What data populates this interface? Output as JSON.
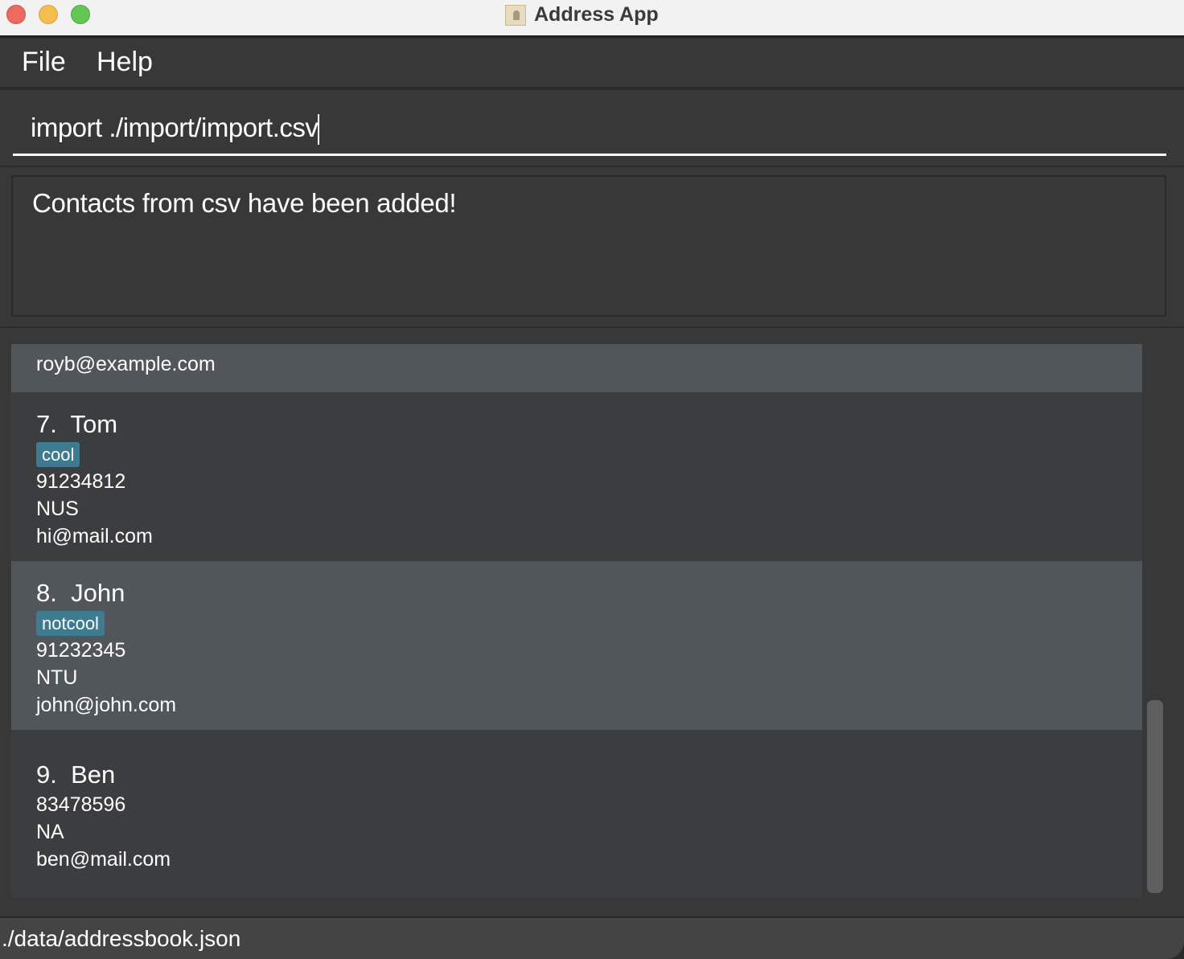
{
  "window": {
    "title": "Address App",
    "app_icon": "address-book-icon"
  },
  "menu": [
    "File",
    "Help"
  ],
  "command": {
    "value": "import ./import/import.csv"
  },
  "result": {
    "message": "Contacts from csv have been added!"
  },
  "contacts": [
    {
      "email": "royb@example.com"
    },
    {
      "index": "7.",
      "name": "Tom",
      "tags": [
        "cool"
      ],
      "phone": "91234812",
      "address": "NUS",
      "email": "hi@mail.com"
    },
    {
      "index": "8.",
      "name": "John",
      "tags": [
        "notcool"
      ],
      "phone": "91232345",
      "address": "NTU",
      "email": "john@john.com"
    },
    {
      "index": "9.",
      "name": "Ben",
      "tags": [],
      "phone": "83478596",
      "address": "NA",
      "email": "ben@mail.com"
    }
  ],
  "status": {
    "path": "./data/addressbook.json"
  },
  "colors": {
    "tag": "#3e7b91",
    "selected_card": "#50565a",
    "card": "#3c3d3f"
  }
}
